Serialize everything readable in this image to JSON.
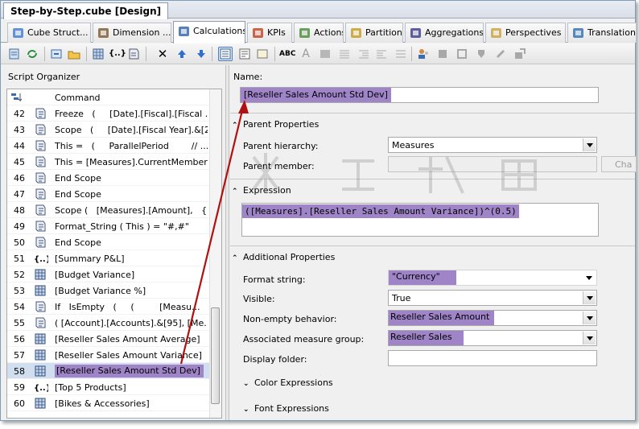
{
  "document_tab": "Step-by-Step.cube [Design]",
  "designer_tabs": [
    {
      "label": "Cube Struct...",
      "icon": "cube-structure-icon"
    },
    {
      "label": "Dimension ...",
      "icon": "dimension-usage-icon"
    },
    {
      "label": "Calculations",
      "icon": "calculations-icon"
    },
    {
      "label": "KPIs",
      "icon": "kpis-icon"
    },
    {
      "label": "Actions",
      "icon": "actions-icon"
    },
    {
      "label": "Partitions",
      "icon": "partitions-icon"
    },
    {
      "label": "Aggregations",
      "icon": "aggregations-icon"
    },
    {
      "label": "Perspectives",
      "icon": "perspectives-icon"
    },
    {
      "label": "Translation",
      "icon": "translations-icon"
    }
  ],
  "active_tab": "Calculations",
  "script_organizer": {
    "title": "Script Organizer",
    "header": "Command",
    "rows": [
      {
        "num": "42",
        "icon": "script-icon",
        "text": "Freeze   (     [Date].[Fiscal].[Fiscal ..."
      },
      {
        "num": "43",
        "icon": "script-icon",
        "text": "Scope   (     [Date].[Fiscal Year].&[2..."
      },
      {
        "num": "44",
        "icon": "script-icon",
        "text": "This =   (     ParallelPeriod        // ..."
      },
      {
        "num": "45",
        "icon": "script-icon",
        "text": "This = [Measures].CurrentMember ..."
      },
      {
        "num": "46",
        "icon": "script-icon",
        "text": "End Scope"
      },
      {
        "num": "47",
        "icon": "script-icon",
        "text": "End Scope"
      },
      {
        "num": "48",
        "icon": "script-icon",
        "text": "Scope (   [Measures].[Amount],   { ..."
      },
      {
        "num": "49",
        "icon": "script-icon",
        "text": "Format_String ( This ) = \"#,#\""
      },
      {
        "num": "50",
        "icon": "script-icon",
        "text": "End Scope"
      },
      {
        "num": "51",
        "icon": "named-set-icon",
        "text": "[Summary P&L]"
      },
      {
        "num": "52",
        "icon": "calculated-member-icon",
        "text": "[Budget Variance]"
      },
      {
        "num": "53",
        "icon": "calculated-member-icon",
        "text": "[Budget Variance %]"
      },
      {
        "num": "54",
        "icon": "script-icon",
        "text": "If   IsEmpty   (     (         [Measu..."
      },
      {
        "num": "55",
        "icon": "script-icon",
        "text": "( [Account].[Accounts].&[95], [Me..."
      },
      {
        "num": "56",
        "icon": "calculated-member-icon",
        "text": "[Reseller Sales Amount Average]"
      },
      {
        "num": "57",
        "icon": "calculated-member-icon",
        "text": "[Reseller Sales Amount Variance]"
      },
      {
        "num": "58",
        "icon": "calculated-member-icon",
        "text": "[Reseller Sales Amount Std Dev]",
        "selected": true
      },
      {
        "num": "59",
        "icon": "named-set-icon",
        "text": "[Top 5 Products]"
      },
      {
        "num": "60",
        "icon": "calculated-member-icon",
        "text": "[Bikes & Accessories]"
      }
    ]
  },
  "properties": {
    "name_label": "Name:",
    "name_value": "[Reseller Sales Amount Std Dev]",
    "parent_section": "Parent Properties",
    "parent_hierarchy_label": "Parent hierarchy:",
    "parent_hierarchy_value": "Measures",
    "parent_member_label": "Parent member:",
    "parent_member_value": "",
    "change_button": "Cha",
    "expression_section": "Expression",
    "expression_value": "([Measures].[Reseller Sales Amount Variance])^(0.5)",
    "additional_section": "Additional Properties",
    "format_string_label": "Format string:",
    "format_string_value": "\"Currency\"",
    "visible_label": "Visible:",
    "visible_value": "True",
    "non_empty_label": "Non-empty behavior:",
    "non_empty_value": "Reseller Sales Amount",
    "measure_group_label": "Associated measure group:",
    "measure_group_value": "Reseller Sales",
    "display_folder_label": "Display folder:",
    "display_folder_value": "",
    "color_section": "Color Expressions",
    "font_section": "Font Expressions"
  },
  "colors": {
    "highlight": "#9f84c8",
    "arrow": "#b01010",
    "selected_row": "#d0deef"
  }
}
